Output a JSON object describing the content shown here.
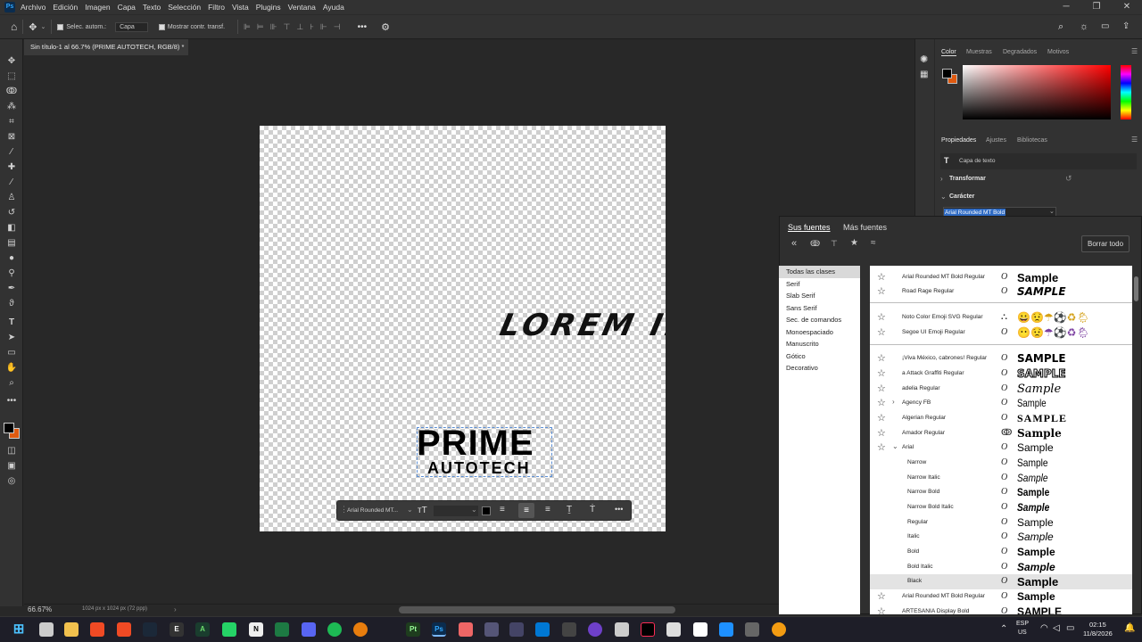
{
  "app": {
    "logo": "Ps"
  },
  "menu": [
    "Archivo",
    "Edición",
    "Imagen",
    "Capa",
    "Texto",
    "Selección",
    "Filtro",
    "Vista",
    "Plugins",
    "Ventana",
    "Ayuda"
  ],
  "options_bar": {
    "auto_select_label": "Selec. autom.:",
    "auto_select_value": "Capa",
    "transform_label": "Mostrar contr. transf."
  },
  "document": {
    "tab_title": "Sin título-1 al 66.7% (PRIME AUTOTECH, RGB/8) *",
    "zoom": "66.67%",
    "info": "1024 px x 1024 px (72 ppp)"
  },
  "canvas": {
    "lorem": "LOREM IP",
    "prime": "PRIME",
    "autotech": "AUTOTECH"
  },
  "context_bar": {
    "font": "Arial Rounded MT..."
  },
  "color_panel": {
    "tabs": [
      "Color",
      "Muestras",
      "Degradados",
      "Motivos"
    ],
    "foreground": "#000000",
    "background": "#e05a10"
  },
  "properties_panel": {
    "tabs": [
      "Propiedades",
      "Ajustes",
      "Bibliotecas"
    ],
    "layer_type": "Capa de texto",
    "transform": "Transformar",
    "character": "Carácter",
    "font_field": "Arial Rounded MT Bold"
  },
  "font_panel": {
    "tab_yours": "Sus fuentes",
    "tab_more": "Más fuentes",
    "clear": "Borrar todo",
    "classes": [
      "Todas las clases",
      "Serif",
      "Slab Serif",
      "Sans Serif",
      "Sec. de comandos",
      "Monoespaciado",
      "Manuscrito",
      "Gótico",
      "Decorativo"
    ],
    "fonts": [
      {
        "name": "Arial Rounded MT Bold Regular",
        "sample": "Sample"
      },
      {
        "name": "Road Rage Regular",
        "sample": "SAMPLE"
      },
      {
        "name": "Noto Color Emoji SVG Regular",
        "sample": "😀😟☂⚽♻🌦"
      },
      {
        "name": "Segoe UI Emoji Regular",
        "sample": "😶😟☂⚽♻🌦"
      },
      {
        "name": "¡Viva México, cabrones! Regular",
        "sample": "SAMPLE"
      },
      {
        "name": "a Attack Graffiti Regular",
        "sample": "SAMPLE"
      },
      {
        "name": "adelia Regular",
        "sample": "Sample"
      },
      {
        "name": "Agency FB",
        "sample": "Sample"
      },
      {
        "name": "Algerian Regular",
        "sample": "SAMPLE"
      },
      {
        "name": "Amador Regular",
        "sample": "Sample"
      },
      {
        "name": "Arial",
        "sample": "Sample"
      },
      {
        "name": "Narrow",
        "sample": "Sample"
      },
      {
        "name": "Narrow Italic",
        "sample": "Sample"
      },
      {
        "name": "Narrow Bold",
        "sample": "Sample"
      },
      {
        "name": "Narrow Bold Italic",
        "sample": "Sample"
      },
      {
        "name": "Regular",
        "sample": "Sample"
      },
      {
        "name": "Italic",
        "sample": "Sample"
      },
      {
        "name": "Bold",
        "sample": "Sample"
      },
      {
        "name": "Bold Italic",
        "sample": "Sample"
      },
      {
        "name": "Black",
        "sample": "Sample"
      },
      {
        "name": "Arial Rounded MT Bold Regular",
        "sample": "Sample"
      },
      {
        "name": "ARTESANIA Display Bold",
        "sample": "SAMPLE"
      }
    ]
  },
  "taskbar": {
    "lang1": "ESP",
    "lang2": "US",
    "time": "02:15",
    "date": "11/8/2026"
  }
}
